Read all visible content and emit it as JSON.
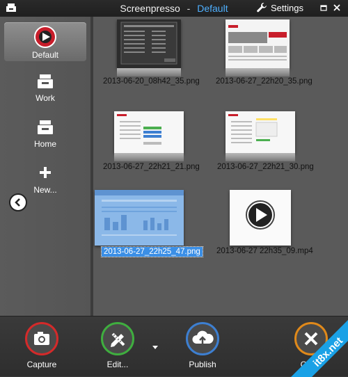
{
  "titlebar": {
    "app_name": "Screenpresso",
    "separator": "-",
    "profile": "Default",
    "settings_label": "Settings"
  },
  "sidebar": {
    "items": [
      {
        "label": "Default",
        "icon": "screenpresso-logo-icon",
        "active": true
      },
      {
        "label": "Work",
        "icon": "tray-icon"
      },
      {
        "label": "Home",
        "icon": "tray-icon"
      },
      {
        "label": "New...",
        "icon": "plus-icon"
      }
    ]
  },
  "thumbnails": [
    {
      "filename": "2013-06-20_08h42_35.png",
      "kind": "image",
      "selected": false
    },
    {
      "filename": "2013-06-27_22h20_35.png",
      "kind": "image",
      "selected": false
    },
    {
      "filename": "2013-06-27_22h21_21.png",
      "kind": "image",
      "selected": false
    },
    {
      "filename": "2013-06-27_22h21_30.png",
      "kind": "image",
      "selected": false
    },
    {
      "filename": "2013-06-27_22h25_47.png",
      "kind": "image",
      "selected": true
    },
    {
      "filename": "2013-06-27 22h35_09.mp4",
      "kind": "video",
      "selected": false
    }
  ],
  "actions": [
    {
      "label": "Capture",
      "icon": "camera-icon",
      "color": "#d42a2a"
    },
    {
      "label": "Edit...",
      "icon": "pencil-ruler-icon",
      "color": "#3fae3f"
    },
    {
      "label": "Publish",
      "icon": "cloud-upload-icon",
      "color": "#3d7fd1"
    },
    {
      "label": "Close",
      "icon": "close-icon",
      "color": "#e0891a"
    }
  ],
  "watermark": "it8x.net"
}
